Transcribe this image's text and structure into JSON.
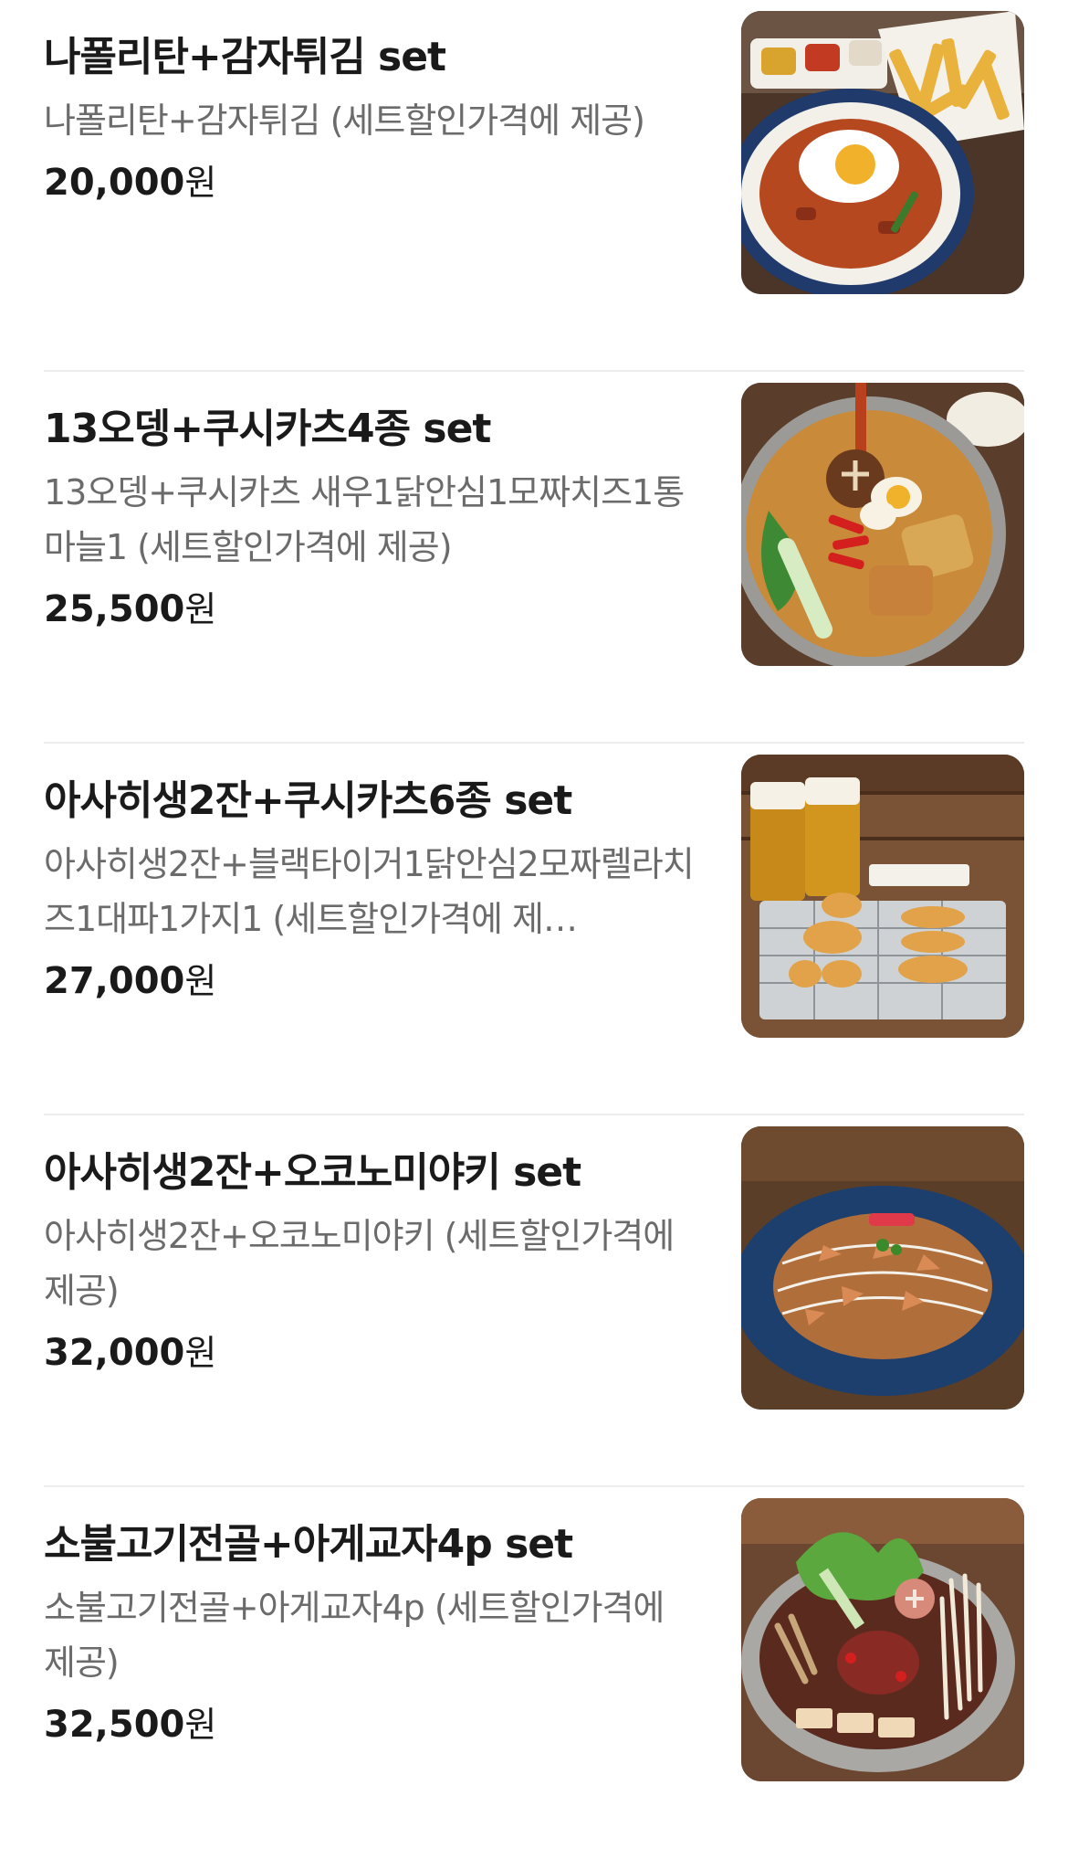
{
  "menu": {
    "items": [
      {
        "name": "나폴리탄+감자튀김 set",
        "description": "나폴리탄+감자튀김 (세트할인가격에 제공)",
        "price": "20,000",
        "currency": "원",
        "photo": "napolitan-fries-photo"
      },
      {
        "name": "13오뎅+쿠시카츠4종 set",
        "description": "13오뎅+쿠시카츠 새우1닭안심1모짜치즈1통마늘1 (세트할인가격에 제공)",
        "price": "25,500",
        "currency": "원",
        "photo": "oden-hotpot-photo"
      },
      {
        "name": "아사히생2잔+쿠시카츠6종 set",
        "description": "아사히생2잔+블랙타이거1닭안심2모짜렐라치즈1대파1가지1 (세트할인가격에 제…",
        "price": "27,000",
        "currency": "원",
        "photo": "beer-kushikatsu-photo"
      },
      {
        "name": "아사히생2잔+오코노미야키 set",
        "description": "아사히생2잔+오코노미야키 (세트할인가격에 제공)",
        "price": "32,000",
        "currency": "원",
        "photo": "okonomiyaki-photo"
      },
      {
        "name": "소불고기전골+아게교자4p set",
        "description": "소불고기전골+아게교자4p (세트할인가격에 제공)",
        "price": "32,500",
        "currency": "원",
        "photo": "bulgogi-hotpot-photo"
      }
    ]
  }
}
